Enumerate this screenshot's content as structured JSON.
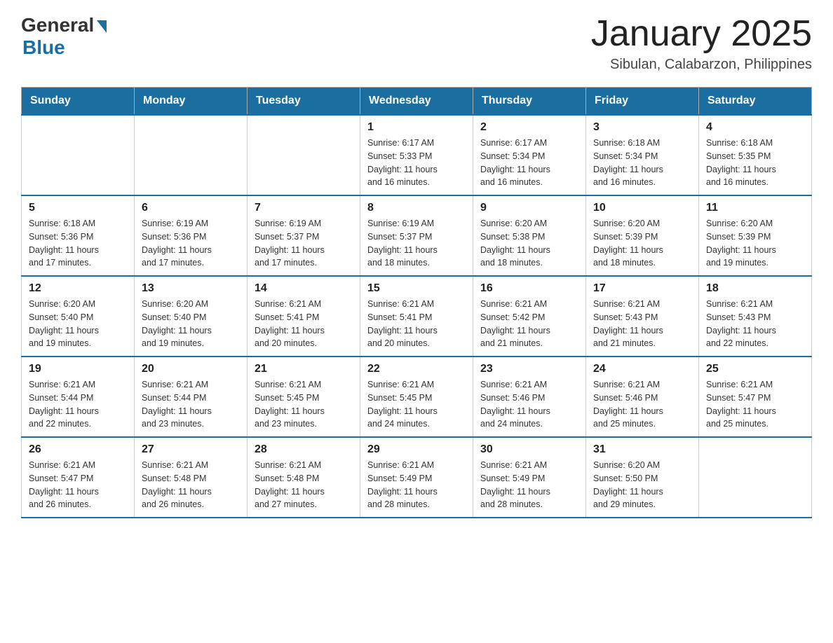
{
  "header": {
    "logo_general": "General",
    "logo_blue": "Blue",
    "month_title": "January 2025",
    "location": "Sibulan, Calabarzon, Philippines"
  },
  "weekdays": [
    "Sunday",
    "Monday",
    "Tuesday",
    "Wednesday",
    "Thursday",
    "Friday",
    "Saturday"
  ],
  "weeks": [
    [
      {
        "day": "",
        "info": ""
      },
      {
        "day": "",
        "info": ""
      },
      {
        "day": "",
        "info": ""
      },
      {
        "day": "1",
        "info": "Sunrise: 6:17 AM\nSunset: 5:33 PM\nDaylight: 11 hours\nand 16 minutes."
      },
      {
        "day": "2",
        "info": "Sunrise: 6:17 AM\nSunset: 5:34 PM\nDaylight: 11 hours\nand 16 minutes."
      },
      {
        "day": "3",
        "info": "Sunrise: 6:18 AM\nSunset: 5:34 PM\nDaylight: 11 hours\nand 16 minutes."
      },
      {
        "day": "4",
        "info": "Sunrise: 6:18 AM\nSunset: 5:35 PM\nDaylight: 11 hours\nand 16 minutes."
      }
    ],
    [
      {
        "day": "5",
        "info": "Sunrise: 6:18 AM\nSunset: 5:36 PM\nDaylight: 11 hours\nand 17 minutes."
      },
      {
        "day": "6",
        "info": "Sunrise: 6:19 AM\nSunset: 5:36 PM\nDaylight: 11 hours\nand 17 minutes."
      },
      {
        "day": "7",
        "info": "Sunrise: 6:19 AM\nSunset: 5:37 PM\nDaylight: 11 hours\nand 17 minutes."
      },
      {
        "day": "8",
        "info": "Sunrise: 6:19 AM\nSunset: 5:37 PM\nDaylight: 11 hours\nand 18 minutes."
      },
      {
        "day": "9",
        "info": "Sunrise: 6:20 AM\nSunset: 5:38 PM\nDaylight: 11 hours\nand 18 minutes."
      },
      {
        "day": "10",
        "info": "Sunrise: 6:20 AM\nSunset: 5:39 PM\nDaylight: 11 hours\nand 18 minutes."
      },
      {
        "day": "11",
        "info": "Sunrise: 6:20 AM\nSunset: 5:39 PM\nDaylight: 11 hours\nand 19 minutes."
      }
    ],
    [
      {
        "day": "12",
        "info": "Sunrise: 6:20 AM\nSunset: 5:40 PM\nDaylight: 11 hours\nand 19 minutes."
      },
      {
        "day": "13",
        "info": "Sunrise: 6:20 AM\nSunset: 5:40 PM\nDaylight: 11 hours\nand 19 minutes."
      },
      {
        "day": "14",
        "info": "Sunrise: 6:21 AM\nSunset: 5:41 PM\nDaylight: 11 hours\nand 20 minutes."
      },
      {
        "day": "15",
        "info": "Sunrise: 6:21 AM\nSunset: 5:41 PM\nDaylight: 11 hours\nand 20 minutes."
      },
      {
        "day": "16",
        "info": "Sunrise: 6:21 AM\nSunset: 5:42 PM\nDaylight: 11 hours\nand 21 minutes."
      },
      {
        "day": "17",
        "info": "Sunrise: 6:21 AM\nSunset: 5:43 PM\nDaylight: 11 hours\nand 21 minutes."
      },
      {
        "day": "18",
        "info": "Sunrise: 6:21 AM\nSunset: 5:43 PM\nDaylight: 11 hours\nand 22 minutes."
      }
    ],
    [
      {
        "day": "19",
        "info": "Sunrise: 6:21 AM\nSunset: 5:44 PM\nDaylight: 11 hours\nand 22 minutes."
      },
      {
        "day": "20",
        "info": "Sunrise: 6:21 AM\nSunset: 5:44 PM\nDaylight: 11 hours\nand 23 minutes."
      },
      {
        "day": "21",
        "info": "Sunrise: 6:21 AM\nSunset: 5:45 PM\nDaylight: 11 hours\nand 23 minutes."
      },
      {
        "day": "22",
        "info": "Sunrise: 6:21 AM\nSunset: 5:45 PM\nDaylight: 11 hours\nand 24 minutes."
      },
      {
        "day": "23",
        "info": "Sunrise: 6:21 AM\nSunset: 5:46 PM\nDaylight: 11 hours\nand 24 minutes."
      },
      {
        "day": "24",
        "info": "Sunrise: 6:21 AM\nSunset: 5:46 PM\nDaylight: 11 hours\nand 25 minutes."
      },
      {
        "day": "25",
        "info": "Sunrise: 6:21 AM\nSunset: 5:47 PM\nDaylight: 11 hours\nand 25 minutes."
      }
    ],
    [
      {
        "day": "26",
        "info": "Sunrise: 6:21 AM\nSunset: 5:47 PM\nDaylight: 11 hours\nand 26 minutes."
      },
      {
        "day": "27",
        "info": "Sunrise: 6:21 AM\nSunset: 5:48 PM\nDaylight: 11 hours\nand 26 minutes."
      },
      {
        "day": "28",
        "info": "Sunrise: 6:21 AM\nSunset: 5:48 PM\nDaylight: 11 hours\nand 27 minutes."
      },
      {
        "day": "29",
        "info": "Sunrise: 6:21 AM\nSunset: 5:49 PM\nDaylight: 11 hours\nand 28 minutes."
      },
      {
        "day": "30",
        "info": "Sunrise: 6:21 AM\nSunset: 5:49 PM\nDaylight: 11 hours\nand 28 minutes."
      },
      {
        "day": "31",
        "info": "Sunrise: 6:20 AM\nSunset: 5:50 PM\nDaylight: 11 hours\nand 29 minutes."
      },
      {
        "day": "",
        "info": ""
      }
    ]
  ]
}
